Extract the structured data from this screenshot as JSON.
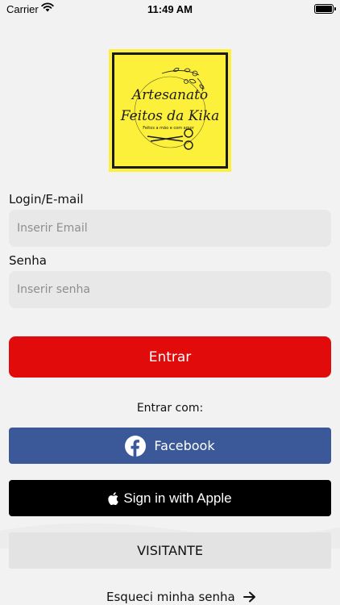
{
  "status_bar": {
    "carrier": "Carrier",
    "time": "11:49 AM",
    "wifi_icon": "wifi-icon",
    "battery_icon": "battery-icon"
  },
  "logo": {
    "line1": "Artesanato",
    "line2": "Feitos da Kika",
    "tagline": "Feitos a mão e com amor",
    "background_color": "#fdf03a",
    "icon": "scissors-icon"
  },
  "form": {
    "login_label": "Login/E-mail",
    "email_placeholder": "Inserir Email",
    "password_label": "Senha",
    "password_placeholder": "Inserir senha",
    "submit_label": "Entrar",
    "submit_color": "#e20b0b"
  },
  "social": {
    "heading": "Entrar com:",
    "facebook_label": "Facebook",
    "facebook_color": "#3b5998",
    "facebook_icon": "facebook-icon",
    "apple_label": "Sign in with Apple",
    "apple_icon": "apple-icon"
  },
  "guest": {
    "label": "VISITANTE"
  },
  "forgot": {
    "label": "Esqueci minha senha",
    "icon": "arrow-right-icon"
  }
}
